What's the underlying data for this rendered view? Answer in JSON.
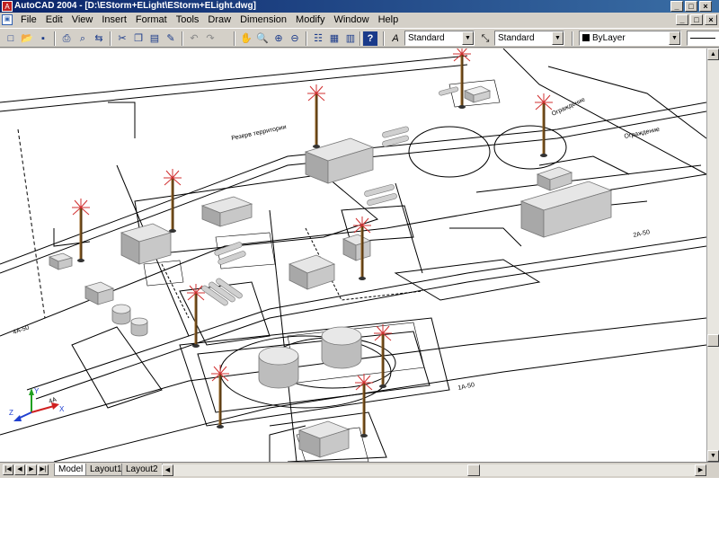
{
  "window": {
    "title": "AutoCAD 2004 - [D:\\EStorm+ELight\\EStorm+ELight.dwg]",
    "controls": [
      "_",
      "□",
      "×"
    ],
    "doc_controls": [
      "_",
      "□",
      "×"
    ]
  },
  "menu": [
    "File",
    "Edit",
    "View",
    "Insert",
    "Format",
    "Tools",
    "Draw",
    "Dimension",
    "Modify",
    "Window",
    "Help"
  ],
  "toolbar": {
    "text_style": "Standard",
    "dim_style": "Standard",
    "layer": "ByLayer"
  },
  "drawing_labels": {
    "road_a": "4A-50",
    "road_b": "4A",
    "road_c": "2A-50",
    "road_d": "1A-50",
    "note_a": "Резерв территории",
    "note_b": "Ограждение",
    "note_c": "Ограждение",
    "ucs_x": "X",
    "ucs_y": "Y",
    "ucs_z": "Z"
  },
  "tabs": {
    "model": "Model",
    "layout1": "Layout1",
    "layout2": "Layout2"
  }
}
